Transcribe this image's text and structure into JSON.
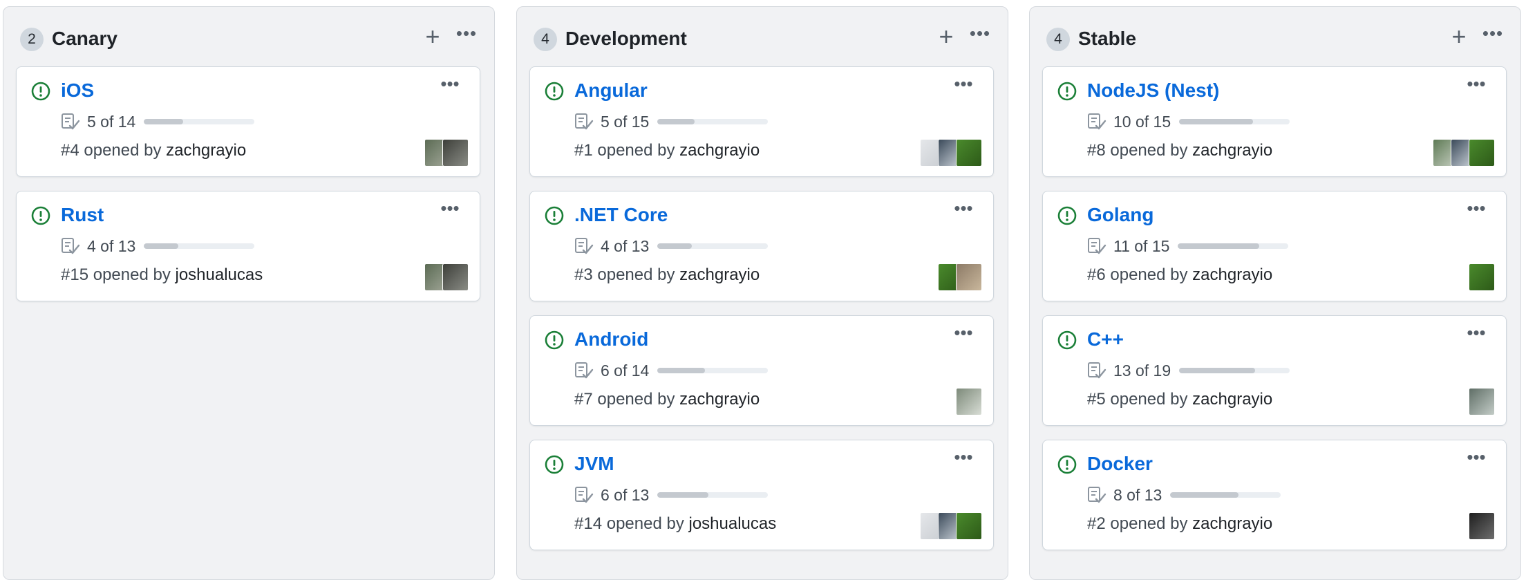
{
  "columns": [
    {
      "name": "Canary",
      "count": "2",
      "cards": [
        {
          "title": "iOS",
          "tasks": "5 of 14",
          "progress": 0.357,
          "number": "#4",
          "opened_by": "opened by",
          "author": "zachgrayio",
          "avatars": [
            {
              "icon": "avatar-photo",
              "colors": [
                "#5b6b54",
                "#a3a89a"
              ]
            },
            {
              "icon": "avatar-photo",
              "colors": [
                "#3d3f3a",
                "#8a8c85"
              ]
            }
          ]
        },
        {
          "title": "Rust",
          "tasks": "4 of 13",
          "progress": 0.308,
          "number": "#15",
          "opened_by": "opened by",
          "author": "joshualucas",
          "avatars": [
            {
              "icon": "avatar-photo",
              "colors": [
                "#5b6b54",
                "#a3a89a"
              ]
            },
            {
              "icon": "avatar-photo",
              "colors": [
                "#3d3f3a",
                "#8a8c85"
              ]
            }
          ]
        }
      ]
    },
    {
      "name": "Development",
      "count": "4",
      "cards": [
        {
          "title": "Angular",
          "tasks": "5 of 15",
          "progress": 0.333,
          "number": "#1",
          "opened_by": "opened by",
          "author": "zachgrayio",
          "avatars": [
            {
              "icon": "avatar-photo",
              "colors": [
                "#e5e7ea",
                "#c9cdd2"
              ]
            },
            {
              "icon": "avatar-photo",
              "colors": [
                "#3b4a5a",
                "#cfd6dd"
              ]
            },
            {
              "icon": "avatar-photo",
              "colors": [
                "#4a8a2c",
                "#2d5a18"
              ]
            }
          ]
        },
        {
          "title": ".NET Core",
          "tasks": "4 of 13",
          "progress": 0.308,
          "number": "#3",
          "opened_by": "opened by",
          "author": "zachgrayio",
          "avatars": [
            {
              "icon": "avatar-photo",
              "colors": [
                "#4a8a2c",
                "#2d5a18"
              ]
            },
            {
              "icon": "avatar-photo",
              "colors": [
                "#8c7a66",
                "#c9b79c"
              ]
            }
          ]
        },
        {
          "title": "Android",
          "tasks": "6 of 14",
          "progress": 0.429,
          "number": "#7",
          "opened_by": "opened by",
          "author": "zachgrayio",
          "avatars": [
            {
              "icon": "avatar-photo",
              "colors": [
                "#7d8a7a",
                "#d8ddd5"
              ]
            }
          ]
        },
        {
          "title": "JVM",
          "tasks": "6 of 13",
          "progress": 0.462,
          "number": "#14",
          "opened_by": "opened by",
          "author": "joshualucas",
          "avatars": [
            {
              "icon": "avatar-photo",
              "colors": [
                "#e5e7ea",
                "#c9cdd2"
              ]
            },
            {
              "icon": "avatar-photo",
              "colors": [
                "#3b4a5a",
                "#cfd6dd"
              ]
            },
            {
              "icon": "avatar-photo",
              "colors": [
                "#4a8a2c",
                "#2d5a18"
              ]
            }
          ]
        }
      ]
    },
    {
      "name": "Stable",
      "count": "4",
      "cards": [
        {
          "title": "NodeJS (Nest)",
          "tasks": "10 of 15",
          "progress": 0.667,
          "number": "#8",
          "opened_by": "opened by",
          "author": "zachgrayio",
          "avatars": [
            {
              "icon": "avatar-photo",
              "colors": [
                "#5e7a55",
                "#c7cfc2"
              ]
            },
            {
              "icon": "avatar-photo",
              "colors": [
                "#3b4a5a",
                "#cfd6dd"
              ]
            },
            {
              "icon": "avatar-photo",
              "colors": [
                "#4a8a2c",
                "#2d5a18"
              ]
            }
          ]
        },
        {
          "title": "Golang",
          "tasks": "11 of 15",
          "progress": 0.733,
          "number": "#6",
          "opened_by": "opened by",
          "author": "zachgrayio",
          "avatars": [
            {
              "icon": "avatar-photo",
              "colors": [
                "#4a8a2c",
                "#2d5a18"
              ]
            }
          ]
        },
        {
          "title": "C++",
          "tasks": "13 of 19",
          "progress": 0.684,
          "number": "#5",
          "opened_by": "opened by",
          "author": "zachgrayio",
          "avatars": [
            {
              "icon": "avatar-photo",
              "colors": [
                "#5f6e66",
                "#c3ccc7"
              ]
            }
          ]
        },
        {
          "title": "Docker",
          "tasks": "8 of 13",
          "progress": 0.615,
          "number": "#2",
          "opened_by": "opened by",
          "author": "zachgrayio",
          "avatars": [
            {
              "icon": "avatar-photo",
              "colors": [
                "#1f1f1f",
                "#6d6d6d"
              ]
            }
          ]
        }
      ]
    }
  ],
  "icons": {
    "column_add": "+",
    "more": "•••",
    "issue": "issue-opened-icon",
    "tasklist": "tasklist-icon"
  },
  "colors": {
    "link": "#0969da",
    "issue_open": "#1a7f37",
    "column_bg": "#f1f2f4"
  }
}
